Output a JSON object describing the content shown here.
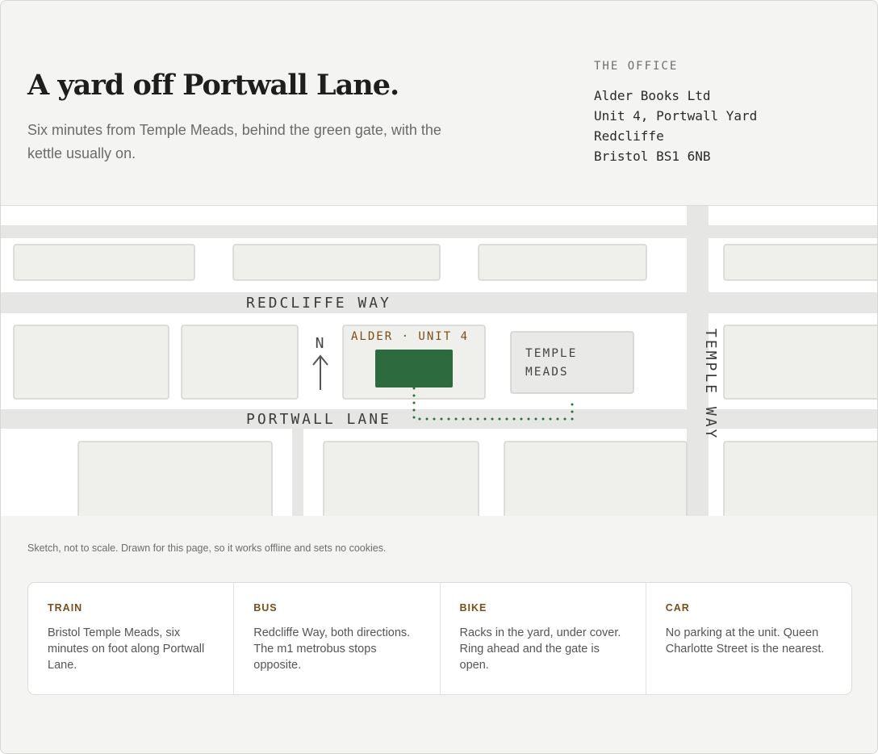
{
  "header": {
    "title": "A yard off Portwall Lane.",
    "subtitle": "Six minutes from Temple Meads, behind the green gate, with the kettle usually on."
  },
  "office": {
    "label": "THE OFFICE",
    "address_lines": [
      "Alder Books Ltd",
      "Unit 4, Portwall Yard",
      "Redcliffe",
      "Bristol BS1 6NB"
    ]
  },
  "map": {
    "streets": {
      "redcliffe_way": "REDCLIFFE WAY",
      "portwall_lane": "PORTWALL LANE",
      "temple_way": "TEMPLE WAY"
    },
    "compass": "N",
    "office_marker_label": "ALDER · UNIT 4",
    "station_label_lines": [
      "TEMPLE",
      "MEADS"
    ],
    "colors": {
      "office_marker": "#2d6a3e",
      "walking_route": "#2d6a3e",
      "office_label": "#7a4e1a",
      "road": "#e6e6e4",
      "block": "#efefeb"
    }
  },
  "note": "Sketch, not to scale. Drawn for this page, so it works offline and sets no cookies.",
  "modes": [
    {
      "label": "TRAIN",
      "text": "Bristol Temple Meads, six minutes on foot along Portwall Lane."
    },
    {
      "label": "BUS",
      "text": "Redcliffe Way, both directions. The m1 metrobus stops opposite."
    },
    {
      "label": "BIKE",
      "text": "Racks in the yard, under cover. Ring ahead and the gate is open."
    },
    {
      "label": "CAR",
      "text": "No parking at the unit. Queen Charlotte Street is the nearest."
    }
  ]
}
